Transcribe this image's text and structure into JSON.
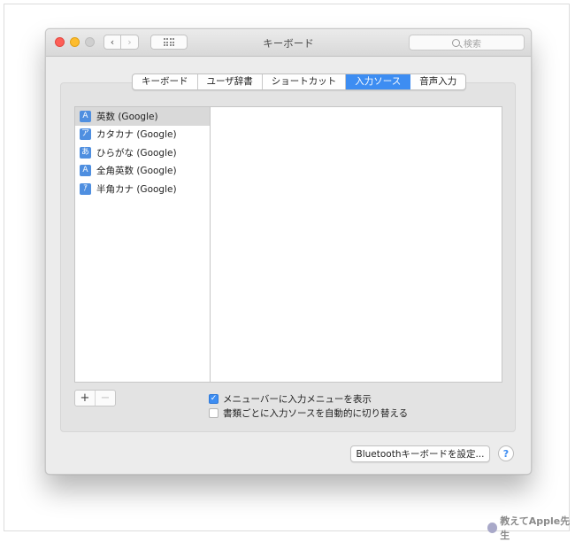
{
  "window": {
    "title": "キーボード",
    "search_placeholder": "検索"
  },
  "tabs": [
    {
      "label": "キーボード",
      "active": false
    },
    {
      "label": "ユーザ辞書",
      "active": false
    },
    {
      "label": "ショートカット",
      "active": false
    },
    {
      "label": "入力ソース",
      "active": true
    },
    {
      "label": "音声入力",
      "active": false
    }
  ],
  "sources": [
    {
      "icon": "A",
      "label": "英数 (Google)",
      "selected": true
    },
    {
      "icon": "ア",
      "label": "カタカナ (Google)",
      "selected": false
    },
    {
      "icon": "あ",
      "label": "ひらがな (Google)",
      "selected": false
    },
    {
      "icon": "A",
      "label": "全角英数 (Google)",
      "selected": false
    },
    {
      "icon": "ｱ",
      "label": "半角カナ (Google)",
      "selected": false
    }
  ],
  "list_controls": {
    "add": "+",
    "remove": "−"
  },
  "options": [
    {
      "label": "メニューバーに入力メニューを表示",
      "checked": true
    },
    {
      "label": "書類ごとに入力ソースを自動的に切り替える",
      "checked": false
    }
  ],
  "footer": {
    "bluetooth_button": "Bluetoothキーボードを設定...",
    "help": "?"
  },
  "watermark": {
    "text": "教えてApple先生"
  },
  "colors": {
    "accent": "#3d8df2",
    "icon_bg": "#4f8fe0"
  }
}
